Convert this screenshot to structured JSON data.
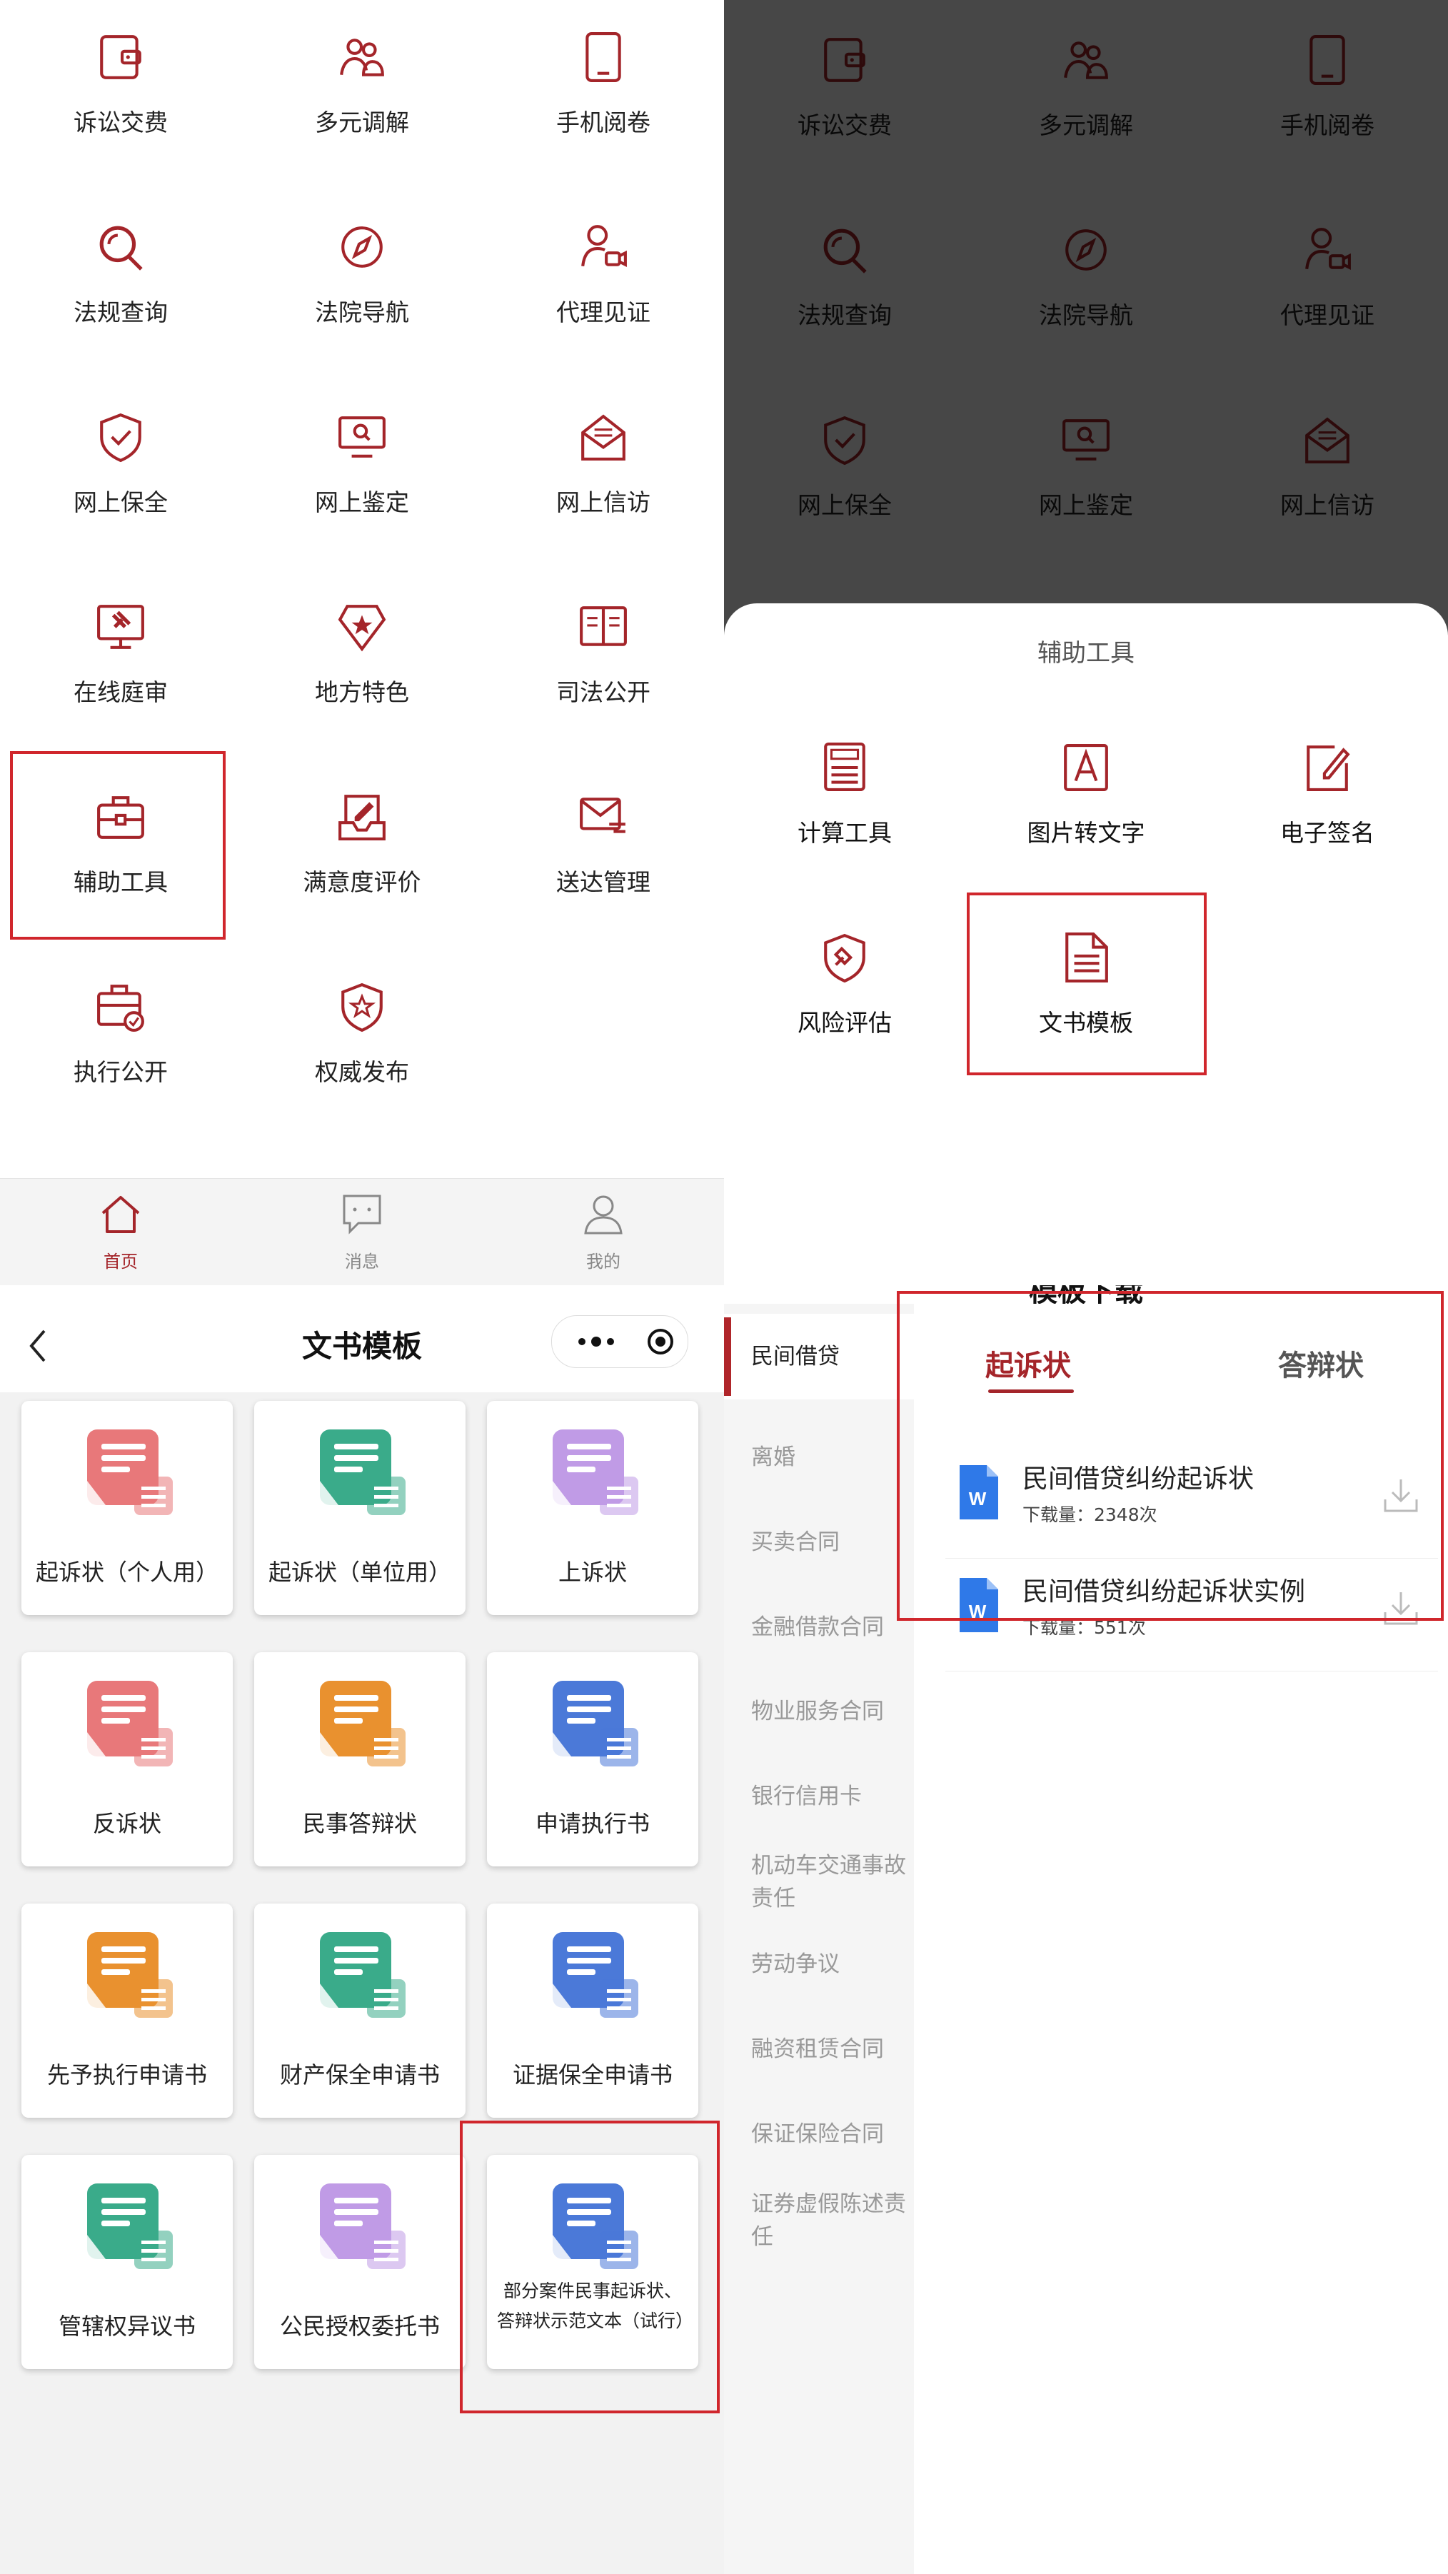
{
  "home": {
    "grid": [
      {
        "label": "诉讼交费",
        "icon": "wallet-icon"
      },
      {
        "label": "多元调解",
        "icon": "people-icon"
      },
      {
        "label": "手机阅卷",
        "icon": "phone-icon"
      },
      {
        "label": "法规查询",
        "icon": "search-icon"
      },
      {
        "label": "法院导航",
        "icon": "compass-icon"
      },
      {
        "label": "代理见证",
        "icon": "user-video-icon"
      },
      {
        "label": "网上保全",
        "icon": "shield-check-icon"
      },
      {
        "label": "网上鉴定",
        "icon": "monitor-search-icon"
      },
      {
        "label": "网上信访",
        "icon": "mail-open-icon"
      },
      {
        "label": "在线庭审",
        "icon": "monitor-gavel-icon"
      },
      {
        "label": "地方特色",
        "icon": "star-badge-icon"
      },
      {
        "label": "司法公开",
        "icon": "book-open-icon"
      },
      {
        "label": "辅助工具",
        "icon": "toolbox-icon"
      },
      {
        "label": "满意度评价",
        "icon": "edit-tray-icon"
      },
      {
        "label": "送达管理",
        "icon": "mail-send-icon"
      },
      {
        "label": "执行公开",
        "icon": "briefcase-check-icon"
      },
      {
        "label": "权威发布",
        "icon": "shield-star-icon"
      }
    ]
  },
  "tabbar": {
    "home": "首页",
    "messages": "消息",
    "mine": "我的"
  },
  "sheet": {
    "title": "辅助工具",
    "items": [
      {
        "label": "计算工具",
        "icon": "calculator-icon"
      },
      {
        "label": "图片转文字",
        "icon": "image-text-icon"
      },
      {
        "label": "电子签名",
        "icon": "signature-icon"
      },
      {
        "label": "风险评估",
        "icon": "shield-gavel-icon"
      },
      {
        "label": "文书模板",
        "icon": "document-icon"
      }
    ]
  },
  "templates": {
    "title": "文书模板",
    "cards": [
      {
        "label": "起诉状（个人用）",
        "color": "#e8787a"
      },
      {
        "label": "起诉状（单位用）",
        "color": "#3aab8a"
      },
      {
        "label": "上诉状",
        "color": "#c09be6"
      },
      {
        "label": "反诉状",
        "color": "#e8787a"
      },
      {
        "label": "民事答辩状",
        "color": "#e9912f"
      },
      {
        "label": "申请执行书",
        "color": "#4b79d8"
      },
      {
        "label": "先予执行申请书",
        "color": "#e9912f"
      },
      {
        "label": "财产保全申请书",
        "color": "#3aab8a"
      },
      {
        "label": "证据保全申请书",
        "color": "#4b79d8"
      },
      {
        "label": "管辖权异议书",
        "color": "#3aab8a"
      },
      {
        "label": "公民授权委托书",
        "color": "#c09be6"
      },
      {
        "label": "部分案件民事起诉状、答辩状示范文本（试行）",
        "color": "#4b79d8"
      }
    ]
  },
  "download": {
    "title": "模板下载",
    "categories": [
      "民间借贷",
      "离婚",
      "买卖合同",
      "金融借款合同",
      "物业服务合同",
      "银行信用卡",
      "机动车交通事故责任",
      "劳动争议",
      "融资租赁合同",
      "保证保险合同",
      "证券虚假陈述责任"
    ],
    "tabs": [
      "起诉状",
      "答辩状"
    ],
    "docs": [
      {
        "title": "民间借贷纠纷起诉状",
        "count": "下载量：2348次"
      },
      {
        "title": "民间借贷纠纷起诉状实例",
        "count": "下载量：551次"
      }
    ]
  },
  "colors": {
    "accent": "#a4252a",
    "highlight": "#d0262c"
  }
}
